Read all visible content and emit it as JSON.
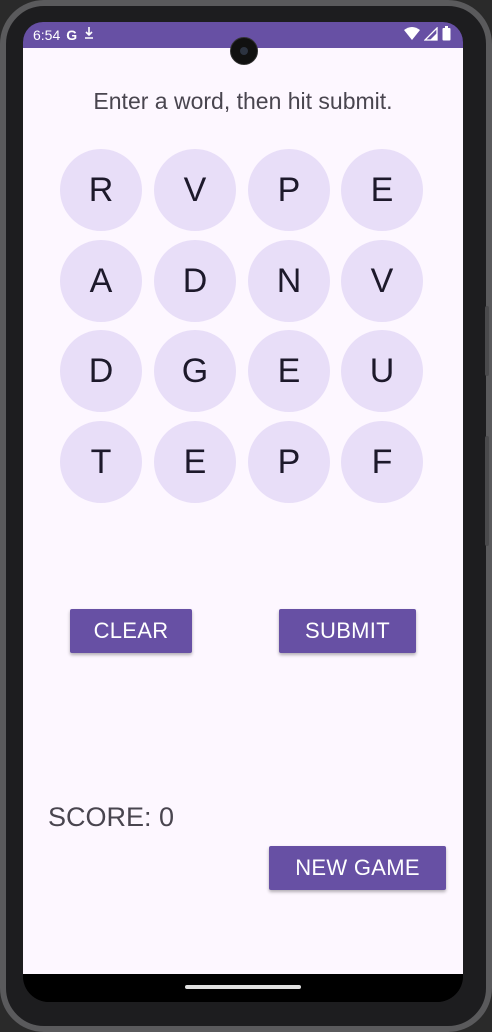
{
  "status_bar": {
    "time": "6:54",
    "icons_left": [
      "google-icon",
      "download-icon"
    ],
    "icons_right": [
      "wifi-icon",
      "signal-icon",
      "battery-icon"
    ],
    "background_color": "#6750a4"
  },
  "app": {
    "instruction": "Enter a word, then hit submit.",
    "tile_color": "#e8def8",
    "grid": [
      [
        "R",
        "V",
        "P",
        "E"
      ],
      [
        "A",
        "D",
        "N",
        "V"
      ],
      [
        "D",
        "G",
        "E",
        "U"
      ],
      [
        "T",
        "E",
        "P",
        "F"
      ]
    ],
    "clear_label": "CLEAR",
    "submit_label": "SUBMIT",
    "score_text": "SCORE: 0",
    "new_game_label": "NEW GAME",
    "accent_color": "#6750a4"
  }
}
